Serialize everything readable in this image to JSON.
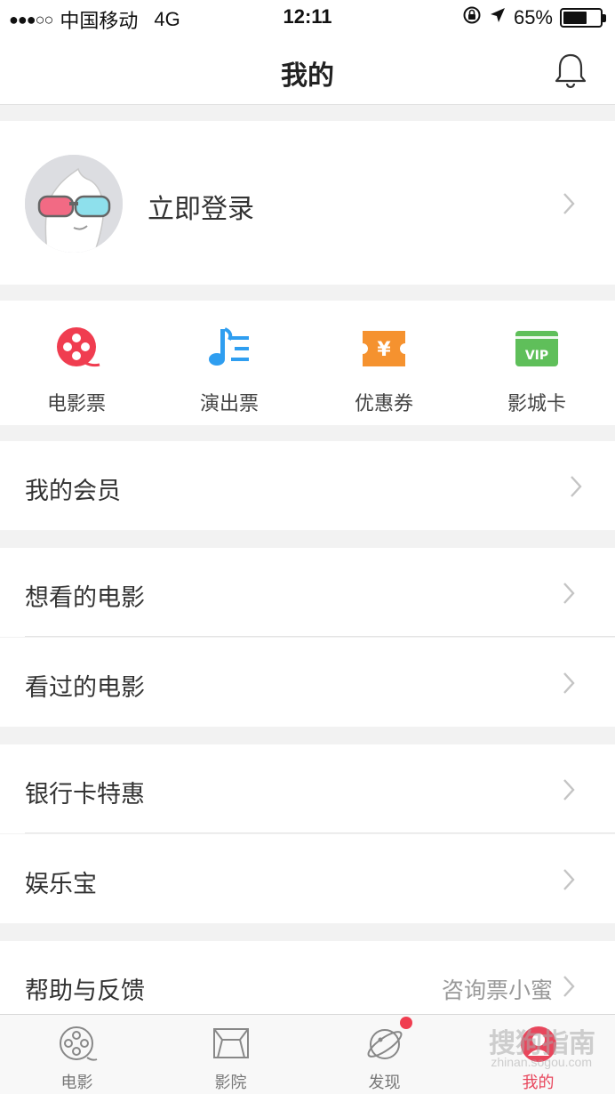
{
  "status_bar": {
    "signal_dots": "●●●○○",
    "carrier": "中国移动",
    "network": "4G",
    "time": "12:11",
    "battery_percent": "65%",
    "battery_level": 0.65,
    "icons": [
      "rotation-lock-icon",
      "location-arrow-icon",
      "battery-icon"
    ]
  },
  "header": {
    "title": "我的",
    "bell_icon": "bell-icon"
  },
  "profile": {
    "login_label": "立即登录",
    "avatar_icon": "avatar-3d-glasses-icon"
  },
  "quick_actions": [
    {
      "label": "电影票",
      "icon": "film-reel-icon",
      "color": "#f03d50"
    },
    {
      "label": "演出票",
      "icon": "music-note-icon",
      "color": "#2f9ef0"
    },
    {
      "label": "优惠券",
      "icon": "coupon-yen-icon",
      "color": "#f5922f"
    },
    {
      "label": "影城卡",
      "icon": "vip-card-icon",
      "color": "#5fbf5a"
    }
  ],
  "menu": {
    "member": "我的会员",
    "want_to_watch": "想看的电影",
    "watched": "看过的电影",
    "bank_card": "银行卡特惠",
    "entertainment": "娱乐宝",
    "help": "帮助与反馈",
    "help_hint": "咨询票小蜜"
  },
  "tab_bar": {
    "tabs": [
      {
        "label": "电影",
        "icon": "film-reel-icon"
      },
      {
        "label": "影院",
        "icon": "cinema-screen-icon"
      },
      {
        "label": "发现",
        "icon": "planet-icon"
      },
      {
        "label": "我的",
        "icon": "user-icon"
      }
    ],
    "active_color": "#e8465c"
  },
  "watermark": {
    "text": "搜狗指南",
    "url": "zhinan.sogou.com"
  }
}
